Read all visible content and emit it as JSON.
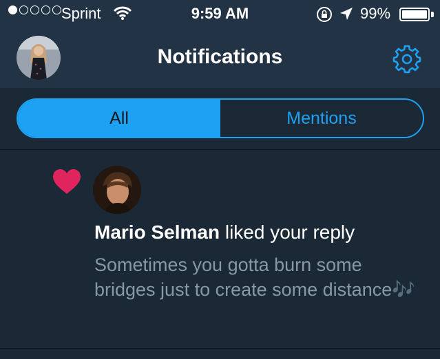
{
  "status_bar": {
    "signal_icon": "signal-dots-icon",
    "carrier": "Sprint",
    "wifi_icon": "wifi-icon",
    "time": "9:59 AM",
    "rotation_lock_icon": "rotation-lock-icon",
    "location_icon": "location-arrow-icon",
    "battery_pct": "99%",
    "battery_level": 0.99
  },
  "header": {
    "title": "Notifications",
    "settings_icon": "gear-icon"
  },
  "tabs": [
    {
      "label": "All",
      "active": true
    },
    {
      "label": "Mentions",
      "active": false
    }
  ],
  "notifications": [
    {
      "icon": "heart-icon",
      "user_name": "Mario Selman",
      "action": " liked your reply",
      "text": "Sometimes you gotta burn some bridges just to create some distance🎶"
    }
  ],
  "colors": {
    "accent": "#1da1f2",
    "background": "#1b2836",
    "header_bg": "#233346",
    "heart": "#e0245e",
    "secondary_text": "#8899a6"
  }
}
